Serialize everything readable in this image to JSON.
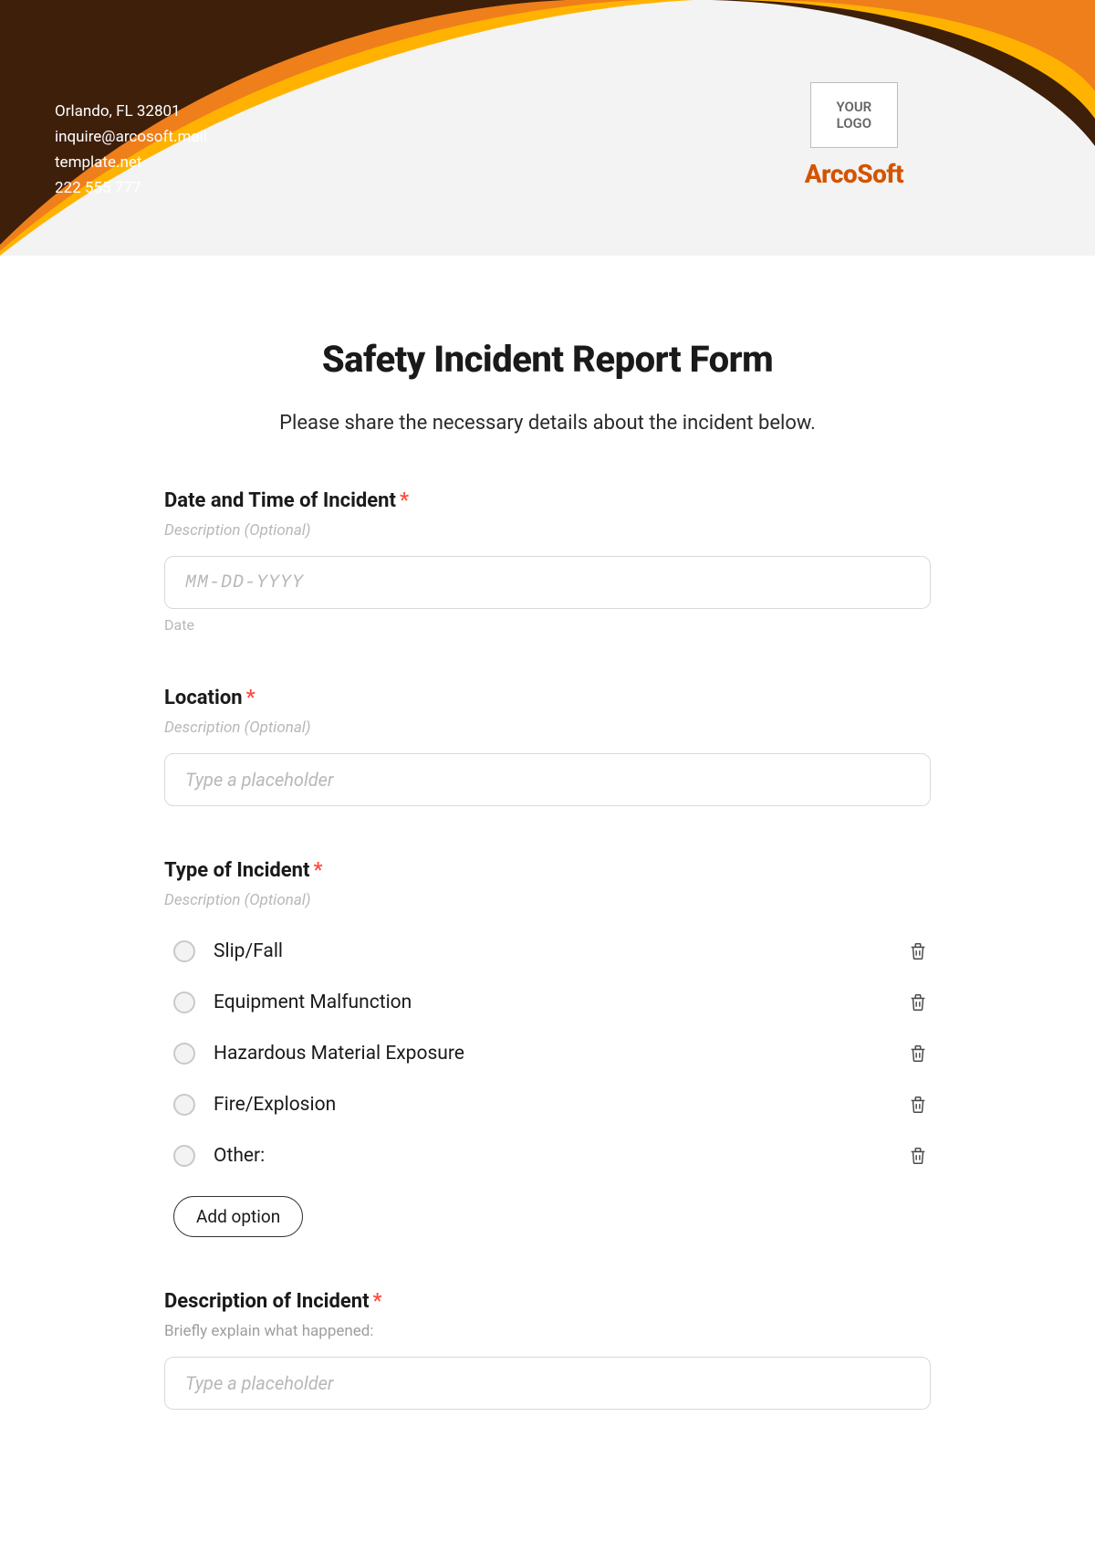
{
  "header": {
    "contact": {
      "address": "Orlando, FL 32801",
      "email": "inquire@arcosoft.mail",
      "website": "template.net",
      "phone": "222 555 777"
    },
    "logo_placeholder": "YOUR\nLOGO",
    "brand": "ArcoSoft"
  },
  "form": {
    "title": "Safety Incident Report Form",
    "subtitle": "Please share the necessary details about the incident below.",
    "description_placeholder": "Description (Optional)",
    "required_mark": "*"
  },
  "fields": {
    "date": {
      "label": "Date and Time of Incident",
      "placeholder": "MM-DD-YYYY",
      "helper": "Date"
    },
    "location": {
      "label": "Location",
      "placeholder": "Type a placeholder"
    },
    "type": {
      "label": "Type of Incident",
      "options": [
        "Slip/Fall",
        "Equipment Malfunction",
        "Hazardous Material Exposure",
        "Fire/Explosion",
        "Other:"
      ],
      "add_option_label": "Add option"
    },
    "description": {
      "label": "Description of Incident",
      "desc": "Briefly explain what happened:",
      "placeholder": "Type a placeholder"
    }
  }
}
